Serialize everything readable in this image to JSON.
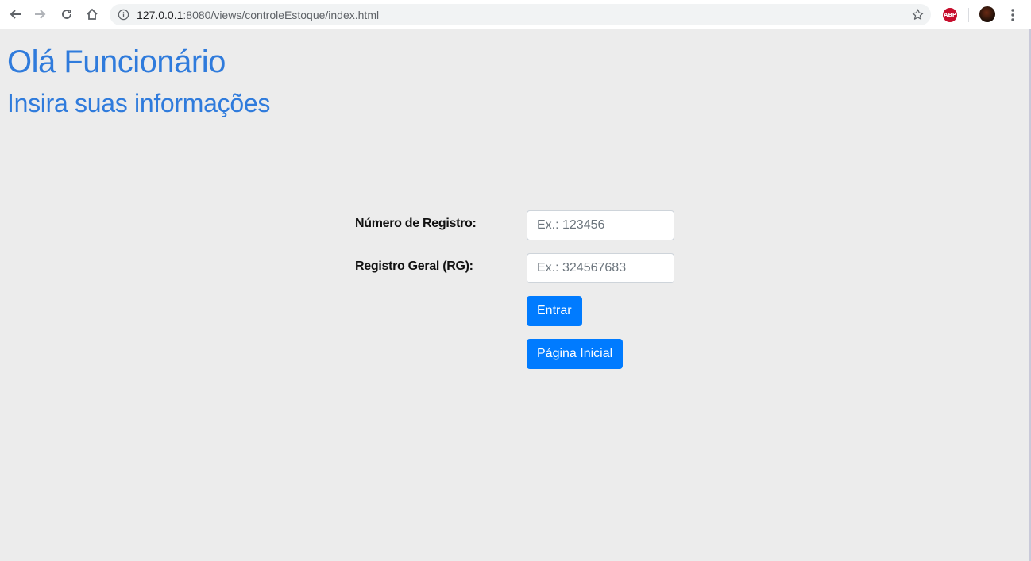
{
  "browser": {
    "url_host": "127.0.0.1",
    "url_path": ":8080/views/controleEstoque/index.html",
    "icons": {
      "back": "back-arrow-icon",
      "forward": "forward-arrow-icon",
      "reload": "reload-icon",
      "home": "home-icon",
      "info": "info-icon",
      "bookmark": "star-icon",
      "adblock": "abp-icon",
      "menu": "kebab-menu-icon"
    },
    "adblock_label": "ABP"
  },
  "page": {
    "title": "Olá Funcionário",
    "subtitle": "Insira suas informações",
    "accent_color": "#2f7bdc",
    "button_color": "#007bff"
  },
  "form": {
    "registro": {
      "label": "Número de Registro:",
      "value": "",
      "placeholder": "Ex.: 123456"
    },
    "rg": {
      "label": "Registro Geral (RG):",
      "value": "",
      "placeholder": "Ex.: 324567683"
    },
    "enter_button": "Entrar",
    "home_button": "Página Inicial"
  }
}
